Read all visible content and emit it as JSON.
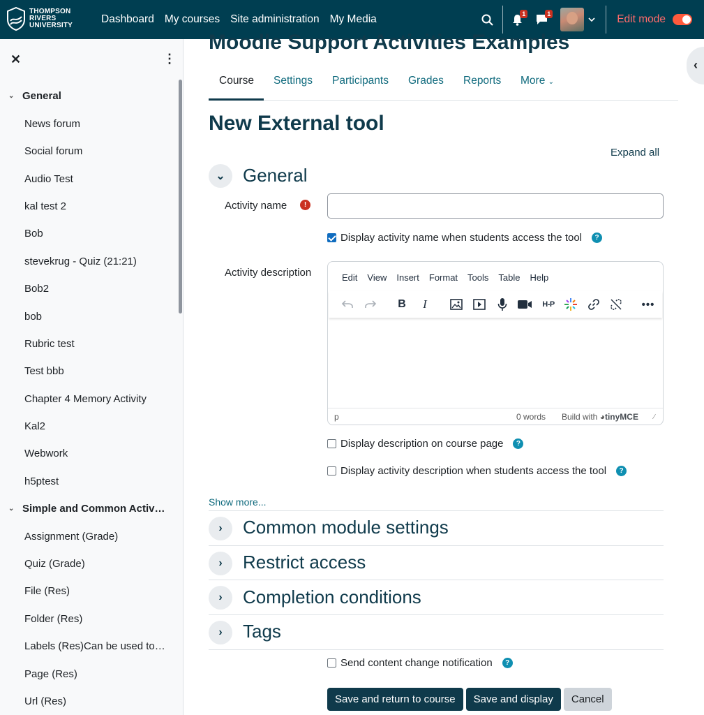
{
  "brand": {
    "logo_text": [
      "THOMPSON",
      "RIVERS",
      "UNIVERSITY"
    ]
  },
  "nav": {
    "links": [
      "Dashboard",
      "My courses",
      "Site administration",
      "My Media"
    ],
    "notifications_count": "1",
    "messages_count": "1",
    "edit_mode_label": "Edit mode",
    "edit_mode_on": true
  },
  "drawer": {
    "sections": [
      {
        "title": "General",
        "expanded": true,
        "items": [
          "News forum",
          "Social forum",
          "Audio Test",
          "kal test 2",
          "Bob",
          "stevekrug - Quiz (21:21)",
          "Bob2",
          "bob",
          "Rubric test",
          "Test bbb",
          "Chapter 4 Memory Activity",
          "Kal2",
          "Webwork",
          "h5ptest"
        ]
      },
      {
        "title": "Simple and Common Activ…",
        "expanded": true,
        "items": [
          "Assignment (Grade)",
          "Quiz (Grade)",
          "File (Res)",
          "Folder (Res)",
          "Labels (Res)Can be used to…",
          "Page (Res)",
          "Url (Res)"
        ]
      }
    ]
  },
  "course": {
    "title": "Moodle Support Activities Examples"
  },
  "tabs": {
    "items": [
      "Course",
      "Settings",
      "Participants",
      "Grades",
      "Reports",
      "More"
    ],
    "active": "Course"
  },
  "form": {
    "heading": "New External tool",
    "expand_all": "Expand all",
    "general_title": "General",
    "activity_name_label": "Activity name",
    "activity_name_value": "",
    "display_name_label": "Display activity name when students access the tool",
    "display_name_checked": true,
    "activity_description_label": "Activity description",
    "editor": {
      "menu": [
        "Edit",
        "View",
        "Insert",
        "Format",
        "Tools",
        "Table",
        "Help"
      ],
      "status_path": "p",
      "word_count": "0 words",
      "build_with": "Build with",
      "brand": "tinyMCE"
    },
    "display_desc_course_label": "Display description on course page",
    "display_desc_course_checked": false,
    "display_desc_tool_label": "Display activity description when students access the tool",
    "display_desc_tool_checked": false,
    "show_more": "Show more...",
    "sections": [
      "Common module settings",
      "Restrict access",
      "Completion conditions",
      "Tags"
    ],
    "send_notification_label": "Send content change notification",
    "send_notification_checked": false,
    "buttons": {
      "save_return": "Save and return to course",
      "save_display": "Save and display",
      "cancel": "Cancel"
    }
  }
}
